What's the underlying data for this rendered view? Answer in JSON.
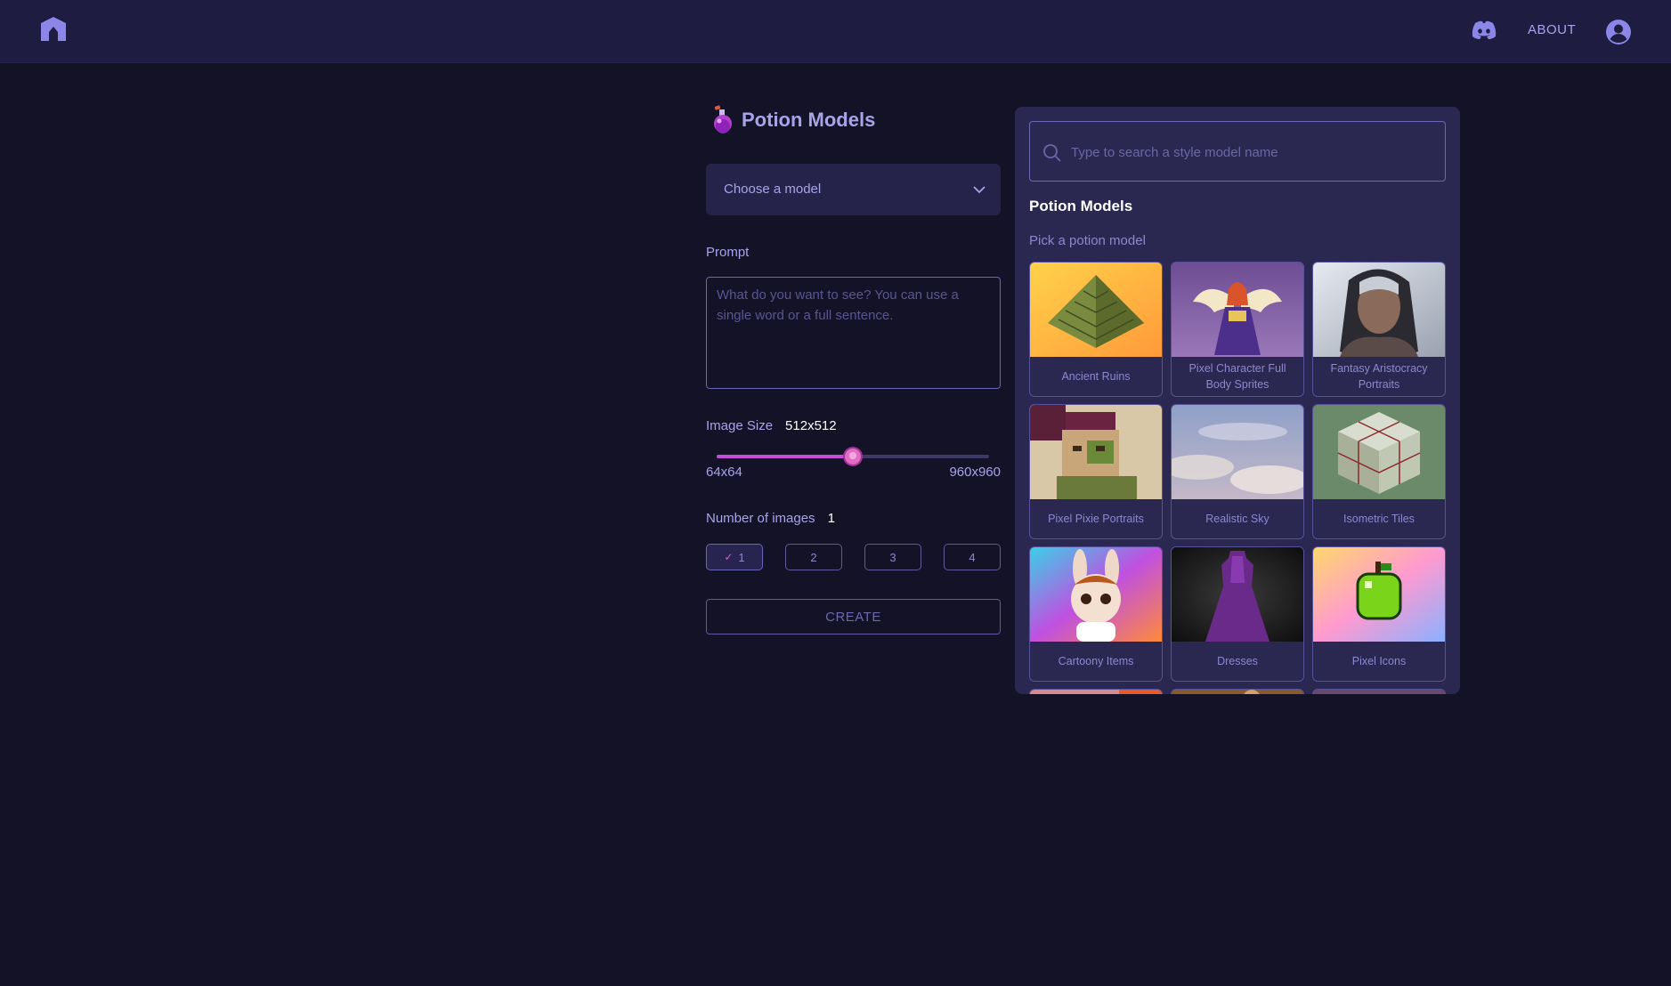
{
  "header": {
    "logo_icon": "home-house-icon",
    "discord_icon": "discord-icon",
    "about_label": "ABOUT",
    "user_icon": "user-account-icon"
  },
  "form": {
    "title": "Potion Models",
    "title_icon": "potion-flask-icon",
    "model_select": {
      "value": "Choose a model"
    },
    "prompt": {
      "label": "Prompt",
      "placeholder": "What do you want to see? You can use a single word or a full sentence.",
      "value": ""
    },
    "image_size": {
      "label": "Image Size",
      "value": "512x512",
      "min_label": "64x64",
      "max_label": "960x960",
      "slider_fraction": 0.5
    },
    "num_images": {
      "label": "Number of images",
      "value": "1",
      "options": [
        "1",
        "2",
        "3",
        "4"
      ],
      "selected": "1"
    },
    "create_label": "CREATE"
  },
  "panel": {
    "search_placeholder": "Type to search a style model name",
    "title": "Potion Models",
    "subtitle": "Pick a potion model",
    "models": [
      {
        "name": "Ancient Ruins"
      },
      {
        "name": "Pixel Character Full Body Sprites"
      },
      {
        "name": "Fantasy Aristocracy Portraits"
      },
      {
        "name": "Pixel Pixie Portraits"
      },
      {
        "name": "Realistic Sky"
      },
      {
        "name": "Isometric Tiles"
      },
      {
        "name": "Cartoony Items"
      },
      {
        "name": "Dresses"
      },
      {
        "name": "Pixel Icons"
      }
    ]
  },
  "colors": {
    "background": "#131226",
    "topbar": "#1e1c40",
    "panel": "#2a2751",
    "accent": "#c04fd6",
    "text_muted": "#a9a3ea"
  }
}
